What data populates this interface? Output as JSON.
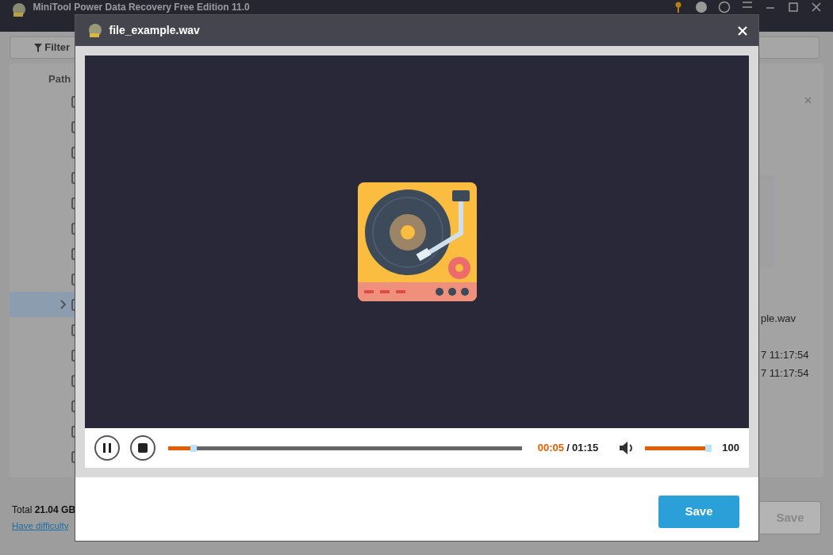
{
  "app": {
    "title": "MiniTool Power Data Recovery Free Edition 11.0",
    "filter_button": "Filter",
    "file_list": {
      "column_header": "Path",
      "rows": [
        {
          "selected": false,
          "expandable": false
        },
        {
          "selected": false,
          "expandable": false
        },
        {
          "selected": false,
          "expandable": false
        },
        {
          "selected": false,
          "expandable": false
        },
        {
          "selected": false,
          "expandable": false
        },
        {
          "selected": false,
          "expandable": false
        },
        {
          "selected": false,
          "expandable": false
        },
        {
          "selected": false,
          "expandable": false
        },
        {
          "selected": true,
          "expandable": true
        },
        {
          "selected": false,
          "expandable": false
        },
        {
          "selected": false,
          "expandable": false
        },
        {
          "selected": false,
          "expandable": false
        },
        {
          "selected": false,
          "expandable": false
        },
        {
          "selected": false,
          "expandable": false
        },
        {
          "selected": false,
          "expandable": false
        }
      ]
    },
    "details": [
      "ple.wav",
      "7 11:17:54",
      "7 11:17:54"
    ],
    "total_label": "Total",
    "total_value": "21.04 GB",
    "help_link": "Have difficulty",
    "save_button": {
      "label": "Save",
      "disabled": true
    }
  },
  "preview": {
    "title": "file_example.wav",
    "player": {
      "playing": true,
      "progress": {
        "level": 0.072
      },
      "elapsed": "00:05",
      "separator": "/",
      "duration": "01:15",
      "volume": {
        "level": 1.0
      },
      "volume_reading": "100"
    },
    "save_button": {
      "label": "Save",
      "disabled": false
    }
  }
}
